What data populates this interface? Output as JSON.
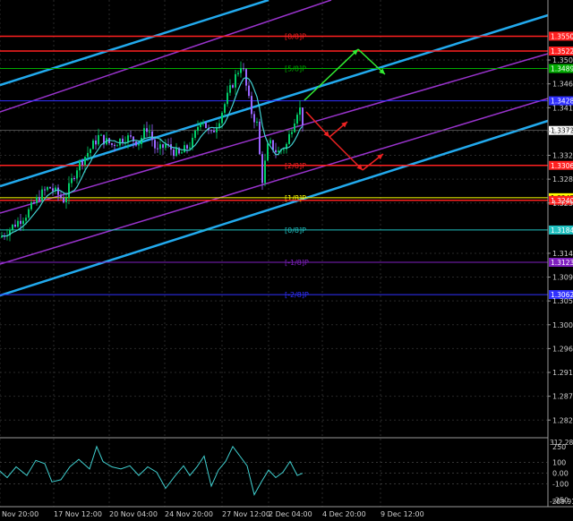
{
  "chart_data": {
    "type": "candlestick",
    "main": {
      "y_range": [
        1.2795,
        1.3615
      ],
      "price_ticks": [
        1.3505,
        1.346,
        1.3415,
        1.337,
        1.3325,
        1.328,
        1.3235,
        1.314,
        1.3095,
        1.305,
        1.3005,
        1.296,
        1.2915,
        1.287,
        1.2825
      ],
      "x_ticks": [
        "Nov 20:00",
        "17 Nov 12:00",
        "20 Nov 04:00",
        "24 Nov 20:00",
        "27 Nov 12:00",
        "2 Dec 04:00",
        "4 Dec 20:00",
        "9 Dec 12:00"
      ],
      "murrey_levels": [
        {
          "label": "[8/8]P",
          "price": 1.355,
          "tag": "1.3550",
          "color": "#ff2020"
        },
        {
          "label": "",
          "price": 1.3522,
          "tag": "1.3522",
          "color": "#ff2020"
        },
        {
          "label": "[5/8]P",
          "price": 1.3489,
          "tag": "1.3489",
          "color": "#00aa00"
        },
        {
          "label": "",
          "price": 1.3428,
          "tag": "1.3428",
          "color": "#3030ff"
        },
        {
          "label": "[2/8]P",
          "price": 1.3306,
          "tag": "1.3306",
          "color": "#ff2020"
        },
        {
          "label": "[1/8]P",
          "price": 1.3245,
          "tag": "1.3245",
          "color": "#ffff00"
        },
        {
          "label": "",
          "price": 1.324,
          "tag": "1.3240",
          "color": "#ff2020"
        },
        {
          "label": "[0/8]P",
          "price": 1.3184,
          "tag": "1.3184",
          "color": "#20c0c0"
        },
        {
          "label": "[-1/8]P",
          "price": 1.3123,
          "tag": "1.3123",
          "color": "#8020c0"
        },
        {
          "label": "[-2/8]P",
          "price": 1.3062,
          "tag": "1.3062",
          "color": "#3030ff"
        }
      ],
      "current_price": 1.3372
    },
    "cci": {
      "top_label": "312.2872",
      "bottom_label": "-289.914",
      "y_range": [
        -295,
        315
      ],
      "ticks": [
        250,
        100,
        0,
        -100,
        -250
      ],
      "tick_labels": [
        "250",
        "100",
        "0.00",
        "-100",
        "-250"
      ]
    }
  }
}
